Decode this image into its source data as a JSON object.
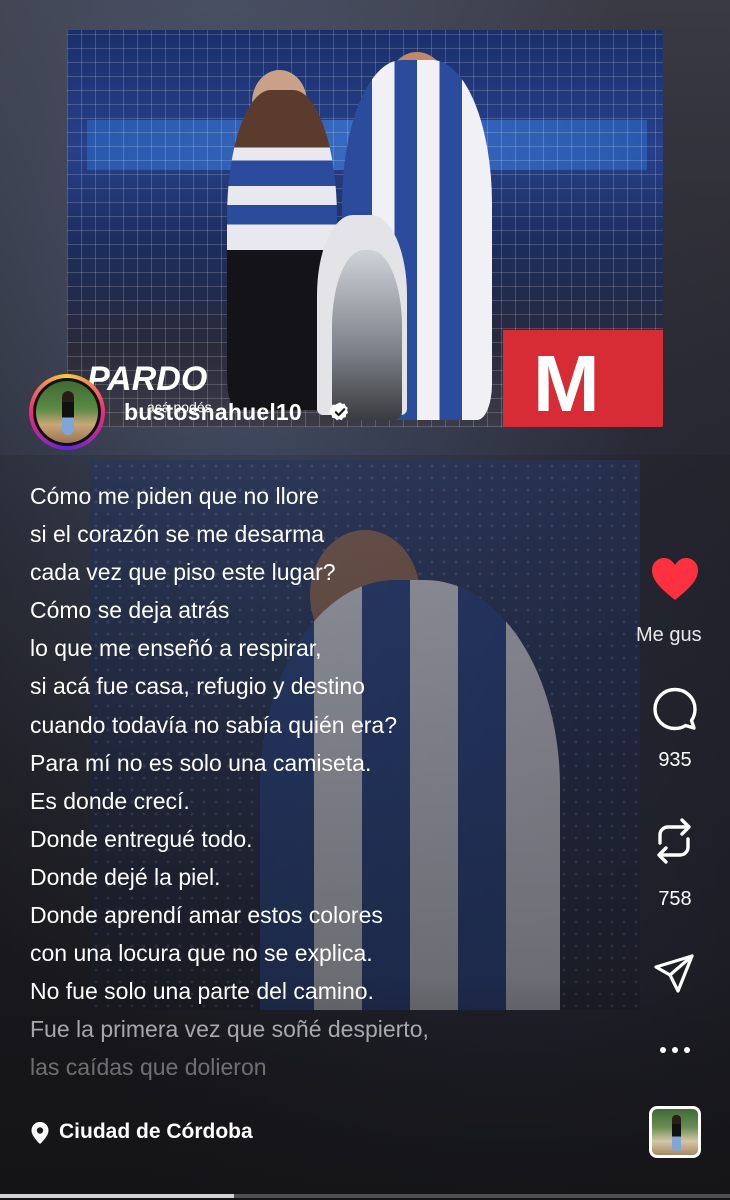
{
  "profile": {
    "username": "bustosnahuel10",
    "verified": true
  },
  "caption": {
    "lines": [
      "Cómo me piden que no llore",
      "si el corazón se me desarma",
      "cada vez que piso este lugar?",
      "Cómo se deja atrás",
      "lo que me enseñó a respirar,",
      "si acá fue casa, refugio y destino",
      "cuando todavía no sabía quién era?",
      "Para mí no es solo una camiseta.",
      "Es donde crecí.",
      "Donde entregué todo.",
      "Donde dejé la piel.",
      "Donde aprendí amar estos colores",
      "con una locura que no se explica.",
      "No fue solo una parte del camino.",
      "Fue la primera vez que soñé despierto,",
      "las caídas que dolieron"
    ]
  },
  "actions": {
    "like_label": "Me gus",
    "comment_count": "935",
    "repost_count": "758"
  },
  "location": {
    "label": "Ciudad de Córdoba"
  },
  "photo": {
    "board_brand": "PARDO",
    "board_sub": "acá podés",
    "board_letter": "M"
  },
  "progress": 0.32,
  "icons": {
    "like": "heart-icon",
    "comment": "comment-icon",
    "repost": "repost-icon",
    "share": "send-icon",
    "more": "more-icon",
    "location": "location-pin-icon",
    "verified": "verified-badge-icon"
  },
  "colors": {
    "like": "#ff3040",
    "text": "#ffffff",
    "avatar_ring": [
      "#f9ce34",
      "#ee2a7b",
      "#6228d7"
    ]
  }
}
